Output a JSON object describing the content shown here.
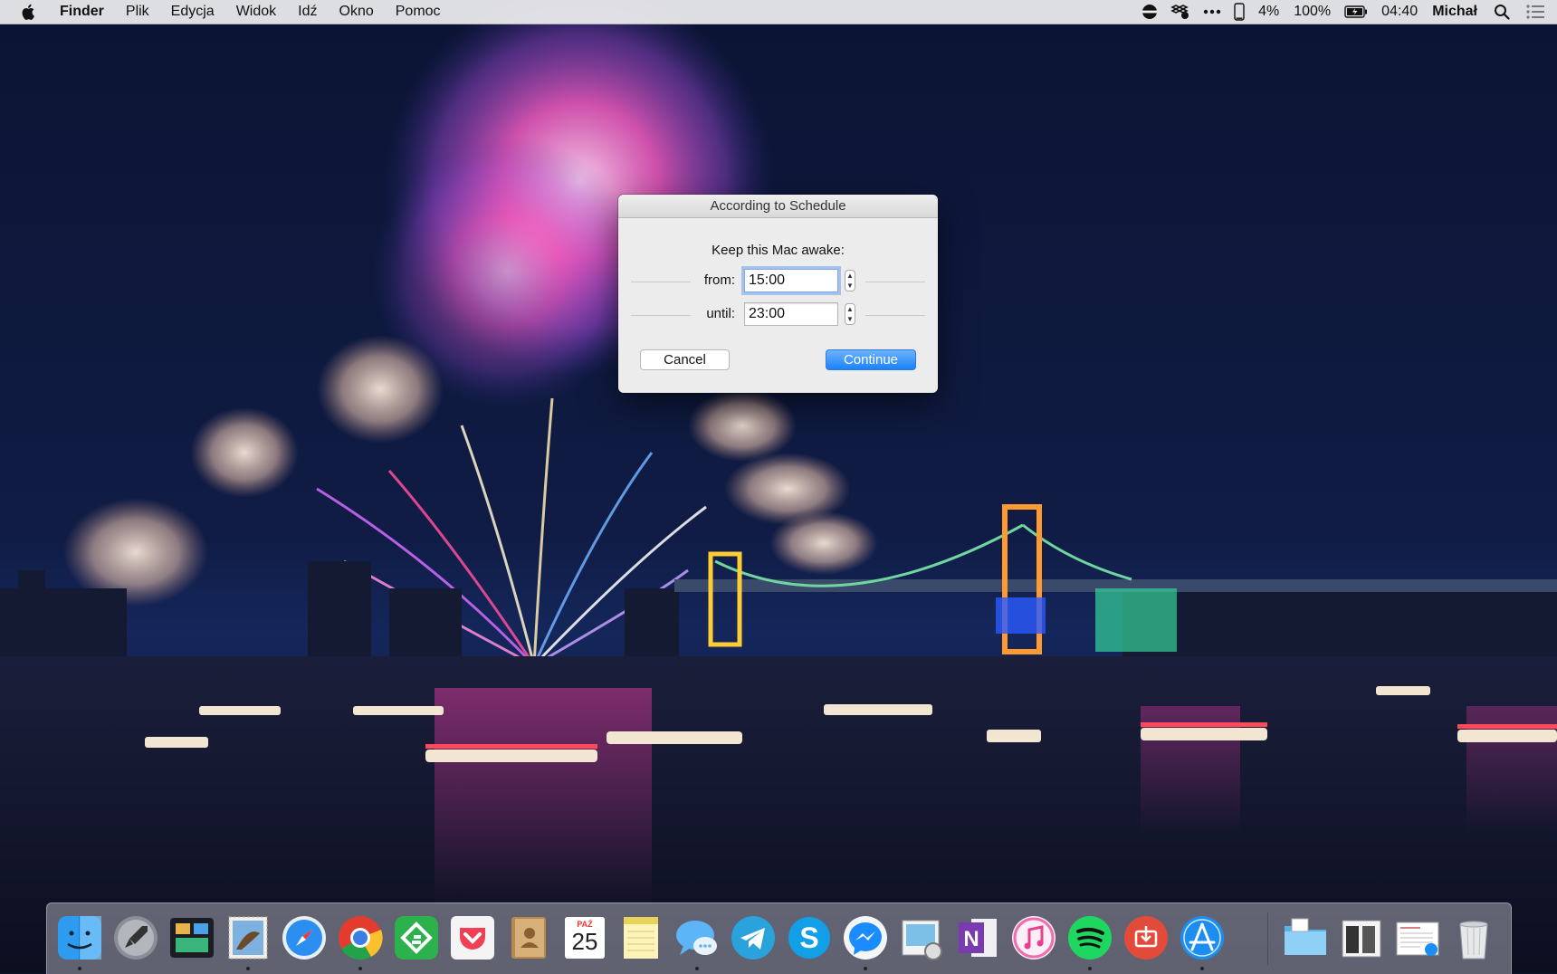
{
  "menubar": {
    "app": "Finder",
    "menus": [
      "Plik",
      "Edycja",
      "Widok",
      "Idź",
      "Okno",
      "Pomoc"
    ],
    "status": {
      "icons": [
        "caffeine-icon",
        "dropbox-icon",
        "more-icon",
        "phone-battery-icon"
      ],
      "phone_battery": "4%",
      "battery": "100%",
      "time": "04:40",
      "user": "Michał"
    }
  },
  "dialog": {
    "title": "According to Schedule",
    "prompt": "Keep this Mac awake:",
    "from_label": "from:",
    "from_value": "15:00",
    "until_label": "until:",
    "until_value": "23:00",
    "cancel_label": "Cancel",
    "continue_label": "Continue"
  },
  "dock": {
    "apps": [
      "Finder",
      "Launchpad",
      "Mission Control",
      "Mail",
      "Safari",
      "Chrome",
      "Feedly",
      "Pocket",
      "Contacts",
      "Calendar",
      "Notes",
      "Messages",
      "Telegram",
      "Skype",
      "Messenger",
      "Preview",
      "OneNote",
      "iTunes",
      "Spotify",
      "Transmit",
      "App Store",
      "Downloads",
      "Documents",
      "Desktop",
      "Trash"
    ],
    "calendar_month": "PAŹ",
    "calendar_day": "25",
    "running_indicators": [
      "Finder",
      "Mail",
      "Chrome",
      "Messages",
      "Messenger",
      "Spotify",
      "App Store"
    ]
  },
  "colors": {
    "accent": "#1a82fb",
    "sky": "#0a1230",
    "menubar": "#eeeef0"
  }
}
